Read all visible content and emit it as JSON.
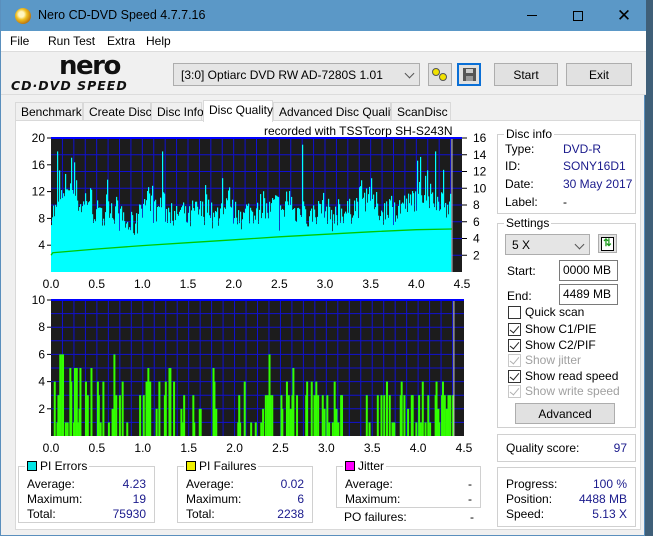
{
  "window": {
    "title": "Nero CD-DVD Speed 4.7.7.16",
    "controls": {
      "minimize": "minimize",
      "maximize": "maximize",
      "close": "close"
    }
  },
  "menu": [
    "File",
    "Run Test",
    "Extra",
    "Help"
  ],
  "logo": {
    "top": "nero",
    "bottom": "CD·DVD SPEED"
  },
  "toolbar": {
    "drive": "[3:0]  Optiarc DVD RW AD-7280S 1.01",
    "start_label": "Start",
    "exit_label": "Exit"
  },
  "tabs": [
    {
      "label": "Benchmark",
      "active": false
    },
    {
      "label": "Create Disc",
      "active": false
    },
    {
      "label": "Disc Info",
      "active": false
    },
    {
      "label": "Disc Quality",
      "active": true
    },
    {
      "label": "Advanced Disc Quality",
      "active": false
    },
    {
      "label": "ScanDisc",
      "active": false
    }
  ],
  "recorded_with": "recorded with TSSTcorp SH-S243N",
  "chart_data": [
    {
      "type": "bar",
      "name": "PI Errors / Read Speed",
      "xlabel": "",
      "ylabel": "",
      "x_ticks": [
        "0.0",
        "0.5",
        "1.0",
        "1.5",
        "2.0",
        "2.5",
        "3.0",
        "3.5",
        "4.0",
        "4.5"
      ],
      "xlim": [
        0,
        4.5
      ],
      "y_ticks_left": [
        "4",
        "8",
        "12",
        "16",
        "20"
      ],
      "ylim_left": [
        0,
        20
      ],
      "y_ticks_right": [
        "2",
        "4",
        "6",
        "8",
        "10",
        "12",
        "14",
        "16"
      ],
      "ylim_right": [
        0,
        16
      ],
      "grid": true,
      "colors": {
        "background": "#1c1c1c",
        "grid": "#1010d0",
        "pi_errors": "#00ffff",
        "read_speed": "#00c800"
      },
      "series": [
        {
          "name": "PI Errors",
          "axis": "left",
          "note": "noisy bars, mostly 8-12 with peaks to 18-19",
          "baseline_profile": [
            9,
            11,
            13,
            12,
            10,
            11,
            9,
            8,
            10,
            9,
            8,
            7,
            7,
            10,
            11,
            9,
            10,
            9,
            8,
            9,
            8,
            9,
            9,
            10,
            8,
            9,
            11,
            9,
            8,
            9,
            9,
            10,
            9,
            10,
            8,
            11,
            9,
            10,
            8,
            9,
            10,
            9,
            8,
            9,
            9,
            10,
            11,
            12,
            10,
            9,
            10,
            9,
            10,
            10,
            11,
            12,
            11,
            10,
            11,
            10
          ],
          "peaks": [
            {
              "x": 0.07,
              "y": 18
            },
            {
              "x": 1.22,
              "y": 18
            },
            {
              "x": 2.75,
              "y": 19
            },
            {
              "x": 4.2,
              "y": 18
            },
            {
              "x": 4.4,
              "y": 17
            }
          ]
        },
        {
          "name": "Read Speed",
          "axis": "right",
          "x": [
            0.0,
            0.02,
            0.5,
            1.0,
            1.5,
            2.0,
            2.5,
            3.0,
            3.5,
            4.0,
            4.39
          ],
          "values": [
            2.0,
            2.3,
            2.75,
            3.15,
            3.5,
            3.85,
            4.2,
            4.5,
            4.8,
            5.05,
            5.13
          ]
        }
      ],
      "end_marker_x": 4.39
    },
    {
      "type": "bar",
      "name": "PI Failures",
      "x_ticks": [
        "0.0",
        "0.5",
        "1.0",
        "1.5",
        "2.0",
        "2.5",
        "3.0",
        "3.5",
        "4.0",
        "4.5"
      ],
      "xlim": [
        0,
        4.5
      ],
      "y_ticks_left": [
        "2",
        "4",
        "6",
        "8",
        "10"
      ],
      "ylim": [
        0,
        10
      ],
      "grid": true,
      "colors": {
        "background": "#1c1c1c",
        "grid": "#1010d0",
        "pi_failures": "#33ff00"
      },
      "series": [
        {
          "name": "PI Failures",
          "points": [
            [
              0.03,
              4
            ],
            [
              0.06,
              1
            ],
            [
              0.07,
              3
            ],
            [
              0.08,
              3
            ],
            [
              0.09,
              6
            ],
            [
              0.11,
              6
            ],
            [
              0.12,
              6
            ],
            [
              0.15,
              1
            ],
            [
              0.17,
              1
            ],
            [
              0.2,
              5
            ],
            [
              0.21,
              4
            ],
            [
              0.24,
              1
            ],
            [
              0.25,
              5
            ],
            [
              0.27,
              5
            ],
            [
              0.28,
              1
            ],
            [
              0.3,
              2
            ],
            [
              0.31,
              5
            ],
            [
              0.37,
              4
            ],
            [
              0.39,
              3
            ],
            [
              0.43,
              5
            ],
            [
              0.5,
              4
            ],
            [
              0.51,
              3
            ],
            [
              0.53,
              1
            ],
            [
              0.56,
              4
            ],
            [
              0.62,
              1
            ],
            [
              0.66,
              2
            ],
            [
              0.68,
              6
            ],
            [
              0.7,
              3
            ],
            [
              0.74,
              3
            ],
            [
              0.77,
              4
            ],
            [
              0.82,
              1
            ],
            [
              0.96,
              3
            ],
            [
              1.0,
              3
            ],
            [
              1.03,
              4
            ],
            [
              1.04,
              3
            ],
            [
              1.05,
              5
            ],
            [
              1.06,
              4
            ],
            [
              1.07,
              4
            ],
            [
              1.14,
              2
            ],
            [
              1.17,
              4
            ],
            [
              1.23,
              3
            ],
            [
              1.24,
              4
            ],
            [
              1.28,
              5
            ],
            [
              1.29,
              5
            ],
            [
              1.33,
              4
            ],
            [
              1.41,
              2
            ],
            [
              1.43,
              1
            ],
            [
              1.44,
              3
            ],
            [
              1.54,
              3
            ],
            [
              1.55,
              1
            ],
            [
              1.61,
              2
            ],
            [
              1.62,
              2
            ],
            [
              1.76,
              5
            ],
            [
              1.77,
              4
            ],
            [
              1.79,
              2
            ],
            [
              2.03,
              1
            ],
            [
              2.04,
              3
            ],
            [
              2.05,
              1
            ],
            [
              2.1,
              4
            ],
            [
              2.17,
              1
            ],
            [
              2.22,
              1
            ],
            [
              2.28,
              1
            ],
            [
              2.3,
              2
            ],
            [
              2.33,
              3
            ],
            [
              2.35,
              3
            ],
            [
              2.37,
              6
            ],
            [
              2.38,
              3
            ],
            [
              2.4,
              3
            ],
            [
              2.5,
              3
            ],
            [
              2.51,
              2
            ],
            [
              2.56,
              4
            ],
            [
              2.58,
              3
            ],
            [
              2.6,
              2
            ],
            [
              2.62,
              3
            ],
            [
              2.63,
              5
            ],
            [
              2.67,
              3
            ],
            [
              2.77,
              3
            ],
            [
              2.78,
              4
            ],
            [
              2.83,
              4
            ],
            [
              2.86,
              3
            ],
            [
              2.88,
              4
            ],
            [
              2.9,
              3
            ],
            [
              2.95,
              3
            ],
            [
              2.97,
              2
            ],
            [
              3.0,
              3
            ],
            [
              3.02,
              1
            ],
            [
              3.06,
              1
            ],
            [
              3.08,
              4
            ],
            [
              3.1,
              2
            ],
            [
              3.12,
              1
            ],
            [
              3.15,
              3
            ],
            [
              3.16,
              3
            ],
            [
              3.43,
              3
            ],
            [
              3.46,
              1
            ],
            [
              3.55,
              3
            ],
            [
              3.59,
              3
            ],
            [
              3.62,
              3
            ],
            [
              3.65,
              4
            ],
            [
              3.68,
              3
            ],
            [
              3.71,
              1
            ],
            [
              3.73,
              1
            ],
            [
              3.8,
              3
            ],
            [
              3.81,
              4
            ],
            [
              3.84,
              3
            ],
            [
              3.88,
              2
            ],
            [
              3.92,
              3
            ],
            [
              3.93,
              3
            ],
            [
              3.97,
              1
            ],
            [
              4.0,
              3
            ],
            [
              4.02,
              1
            ],
            [
              4.04,
              4
            ],
            [
              4.07,
              1
            ],
            [
              4.1,
              3
            ],
            [
              4.12,
              1
            ],
            [
              4.18,
              3
            ],
            [
              4.19,
              4
            ],
            [
              4.21,
              2
            ],
            [
              4.22,
              1
            ],
            [
              4.25,
              3
            ],
            [
              4.26,
              4
            ],
            [
              4.28,
              3
            ],
            [
              4.3,
              2
            ],
            [
              4.32,
              3
            ],
            [
              4.34,
              3
            ],
            [
              4.37,
              3
            ]
          ]
        }
      ],
      "end_marker_x": 4.39
    }
  ],
  "stats": {
    "pi_errors": {
      "title": "PI Errors",
      "color": "#00e5e5",
      "average": "4.23",
      "maximum": "19",
      "total": "75930"
    },
    "pi_failures": {
      "title": "PI Failures",
      "color": "#f0f000",
      "average": "0.02",
      "maximum": "6",
      "total": "2238"
    },
    "jitter": {
      "title": "Jitter",
      "color": "#ff00ff",
      "average": "-",
      "maximum": "-"
    },
    "po_failures": {
      "label": "PO failures:",
      "value": "-"
    },
    "labels": {
      "average": "Average:",
      "maximum": "Maximum:",
      "total": "Total:"
    }
  },
  "disc_info": {
    "title": "Disc info",
    "rows": [
      {
        "label": "Type:",
        "value": "DVD-R"
      },
      {
        "label": "ID:",
        "value": "SONY16D1"
      },
      {
        "label": "Date:",
        "value": "30 May 2017"
      },
      {
        "label": "Label:",
        "value": "-"
      }
    ]
  },
  "settings": {
    "title": "Settings",
    "speed": "5 X",
    "start_label": "Start:",
    "start_value": "0000 MB",
    "end_label": "End:",
    "end_value": "4489 MB",
    "checkboxes": [
      {
        "label": "Quick scan",
        "checked": false,
        "enabled": true
      },
      {
        "label": "Show C1/PIE",
        "checked": true,
        "enabled": true
      },
      {
        "label": "Show C2/PIF",
        "checked": true,
        "enabled": true
      },
      {
        "label": "Show jitter",
        "checked": true,
        "enabled": false
      },
      {
        "label": "Show read speed",
        "checked": true,
        "enabled": true
      },
      {
        "label": "Show write speed",
        "checked": true,
        "enabled": false
      }
    ],
    "advanced_label": "Advanced"
  },
  "quality": {
    "label": "Quality score:",
    "value": "97"
  },
  "progress": {
    "rows": [
      {
        "label": "Progress:",
        "value": "100 %"
      },
      {
        "label": "Position:",
        "value": "4488 MB"
      },
      {
        "label": "Speed:",
        "value": "5.13 X"
      }
    ]
  }
}
